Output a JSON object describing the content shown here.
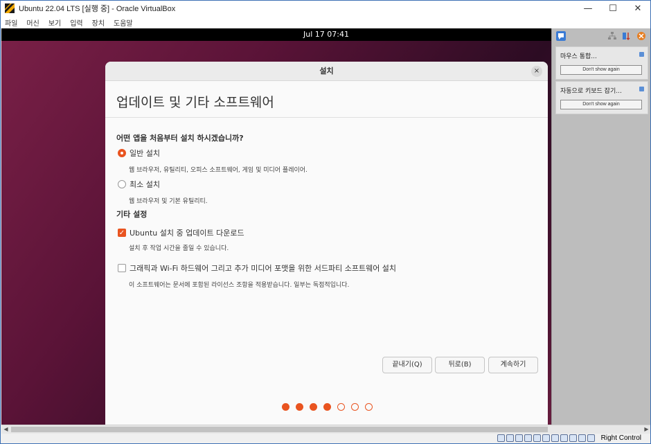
{
  "window": {
    "title": "Ubuntu 22.04 LTS [실행 중] - Oracle VirtualBox",
    "minimize_glyph": "—",
    "maximize_glyph": "☐",
    "close_glyph": "✕",
    "menu": [
      "파일",
      "머신",
      "보기",
      "입력",
      "장치",
      "도움말"
    ]
  },
  "guest": {
    "clock": "Jul 17  07:41"
  },
  "installer": {
    "title": "설치",
    "close_glyph": "×",
    "heading": "업데이트 및 기타 소프트웨어",
    "question": "어떤 앱을 처음부터 설치 하시겠습니까?",
    "options": [
      {
        "label": "일반 설치",
        "desc": "웹 브라우저, 유틸리티, 오피스  소프트웨어, 게임 및 미디어 플레이어.",
        "selected": true
      },
      {
        "label": "최소 설치",
        "desc": "웹 브라우저 및 기본 유틸리티.",
        "selected": false
      }
    ],
    "other_heading": "기타 설정",
    "checks": [
      {
        "label": "Ubuntu 설치 중 업데이트 다운로드",
        "desc": "설치 후 작업 시간을 줄일 수 있습니다.",
        "checked": true
      },
      {
        "label": "그래픽과 Wi-Fi 하드웨어 그리고 추가 미디어 포맷을 위한 서드파티 소프트웨어 설치",
        "desc": "이 소프트웨어는 문서에 포함된 라이선스 조항을 적용받습니다. 일부는 독점적입니다.",
        "checked": false
      }
    ],
    "buttons": {
      "quit": "끝내기(Q)",
      "back": "뒤로(B)",
      "continue": "계속하기"
    },
    "progress": {
      "current_step": 4,
      "total_steps": 7
    }
  },
  "notifications": [
    {
      "text": "마우스 통합...",
      "button": "Don't show again"
    },
    {
      "text": "자동으로 키보드 잡기...",
      "button": "Don't show again"
    }
  ],
  "statusbar": {
    "host_key": "Right Control"
  },
  "colors": {
    "accent": "#e95420",
    "window_border": "#3c6fb4"
  }
}
